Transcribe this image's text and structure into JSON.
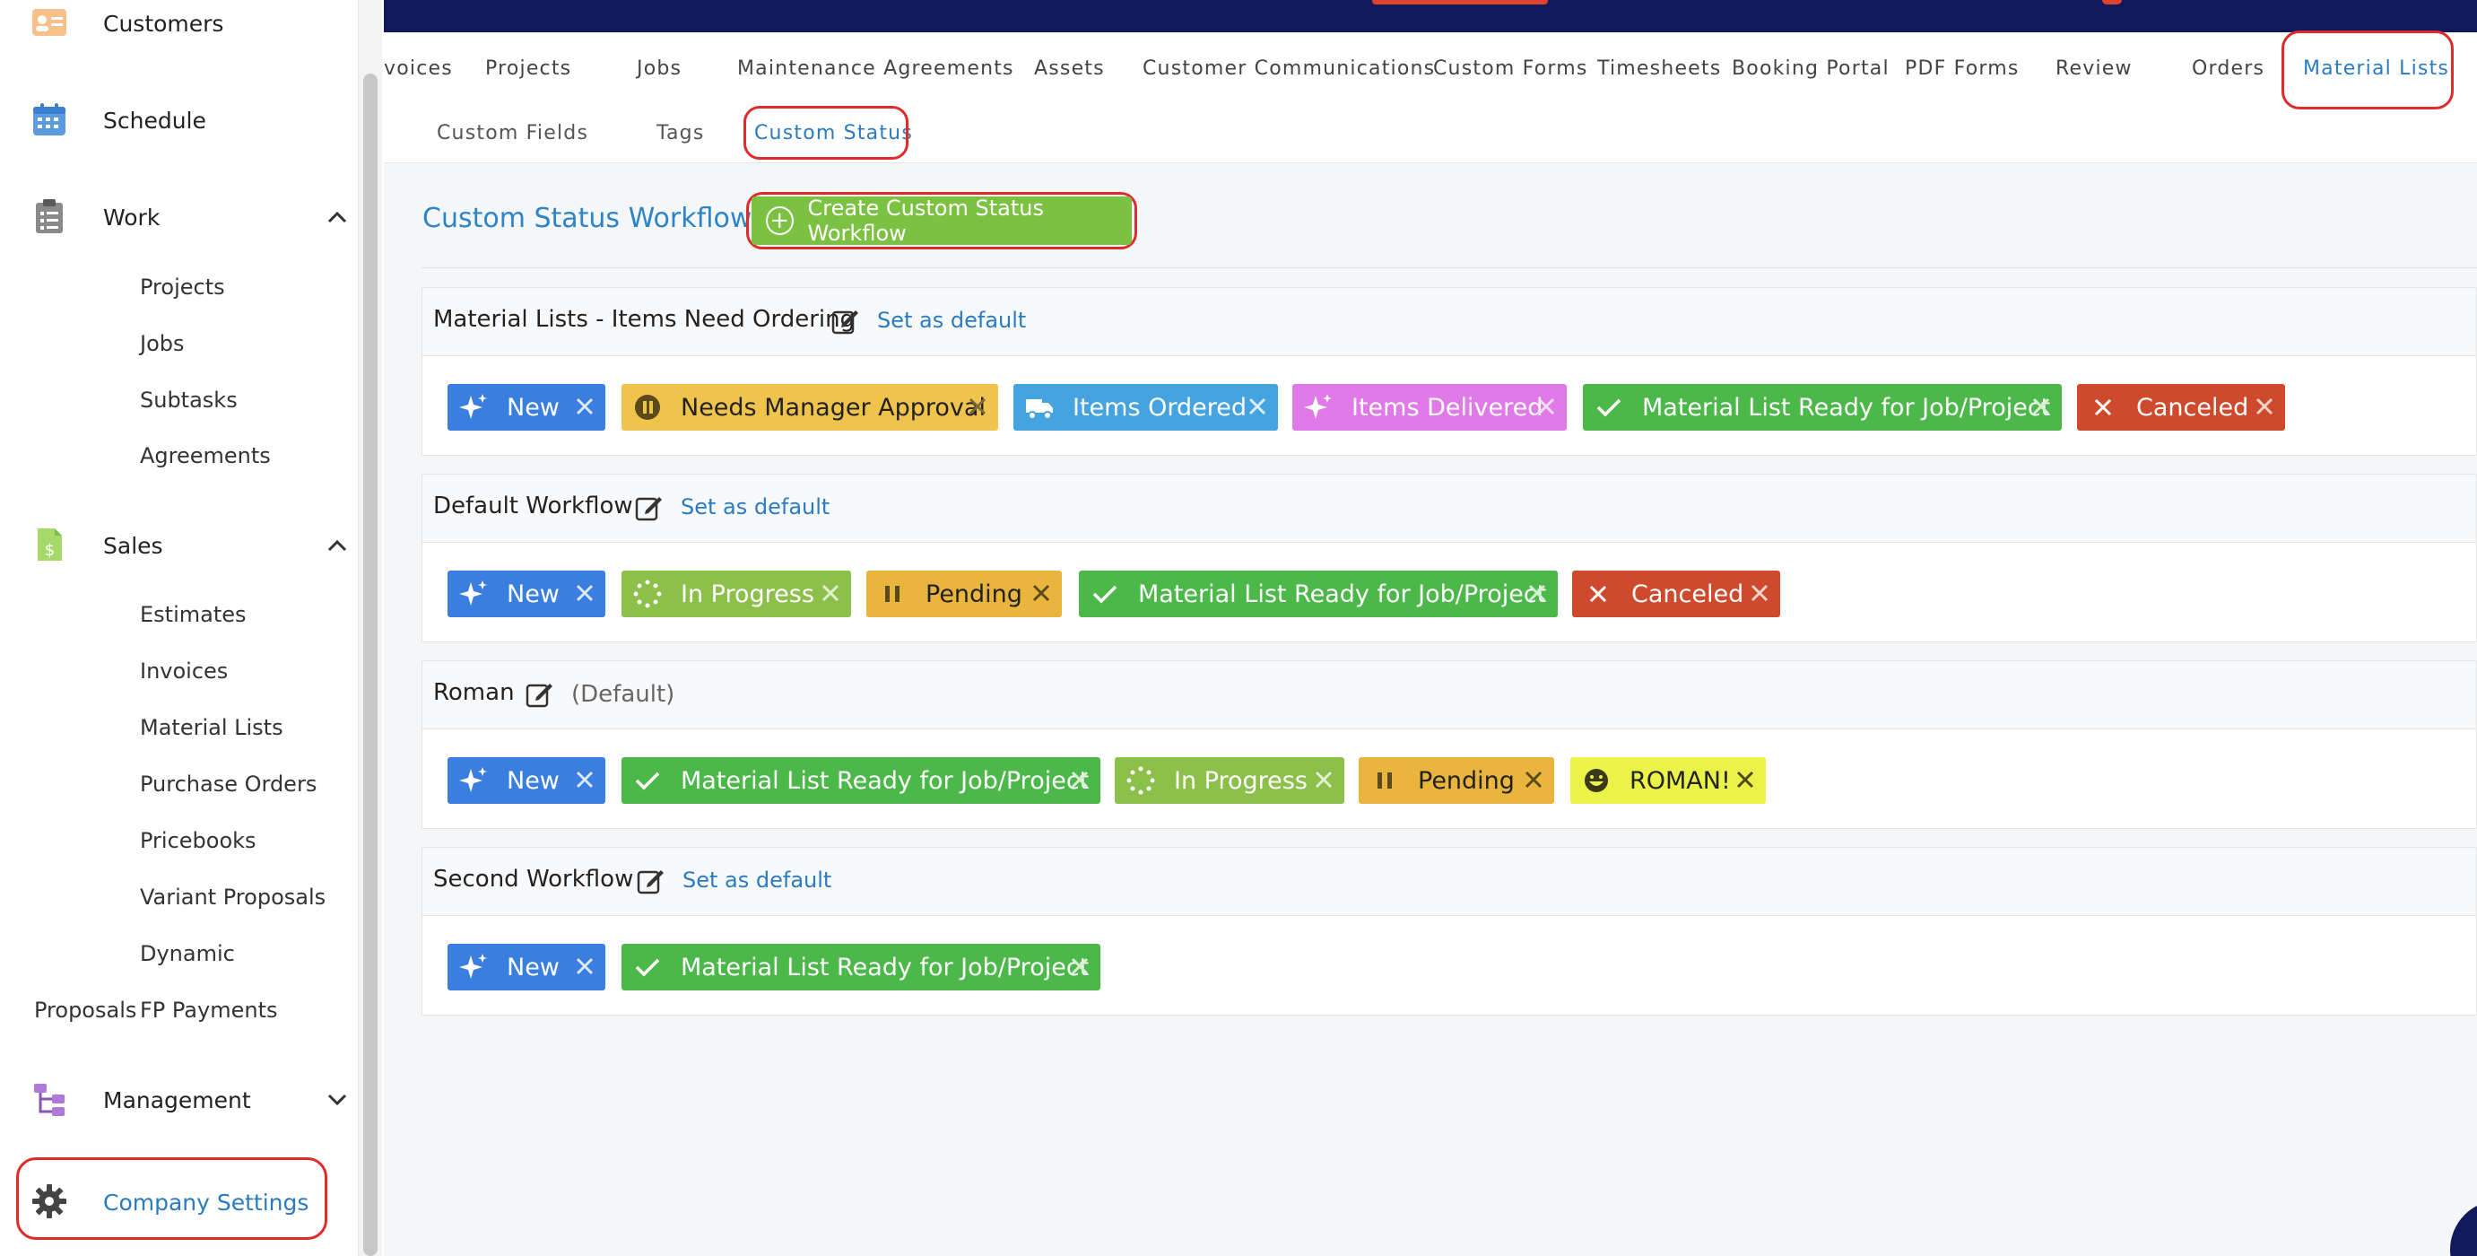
{
  "sidebar": {
    "customers": "Customers",
    "schedule": "Schedule",
    "work": "Work",
    "work_items": [
      "Projects",
      "Jobs",
      "Subtasks",
      "Agreements"
    ],
    "sales": "Sales",
    "sales_items": [
      "Estimates",
      "Invoices",
      "Material Lists",
      "Purchase Orders",
      "Pricebooks",
      "Variant Proposals",
      "Dynamic"
    ],
    "proposals_label": "Proposals",
    "fp_payments": "FP Payments",
    "management": "Management",
    "company_settings": "Company Settings"
  },
  "tabs": [
    "voices",
    "Projects",
    "Jobs",
    "Maintenance Agreements",
    "Assets",
    "Customer Communications",
    "Custom Forms",
    "Timesheets",
    "Booking Portal",
    "PDF Forms",
    "Review",
    "Orders",
    "Material Lists"
  ],
  "active_tab": "Material Lists",
  "subtabs": [
    "Custom Fields",
    "Tags",
    "Custom Status"
  ],
  "active_subtab": "Custom Status",
  "page": {
    "title": "Custom Status Workflows",
    "create_button": "Create Custom Status Workflow"
  },
  "workflows": [
    {
      "name": "Material Lists - Items Need Ordering",
      "link": "Set as default",
      "statuses": [
        "New",
        "Needs Manager Approval",
        "Items Ordered",
        "Items Delivered",
        "Material List Ready for Job/Project",
        "Canceled"
      ]
    },
    {
      "name": "Default Workflow",
      "link": "Set as default",
      "statuses": [
        "New",
        "In Progress",
        "Pending",
        "Material List Ready for Job/Project",
        "Canceled"
      ]
    },
    {
      "name": "Roman",
      "default_label": "(Default)",
      "statuses": [
        "New",
        "Material List Ready for Job/Project",
        "In Progress",
        "Pending",
        "ROMAN!"
      ]
    },
    {
      "name": "Second Workflow",
      "link": "Set as default",
      "statuses": [
        "New",
        "Material List Ready for Job/Project"
      ]
    }
  ],
  "icons": {
    "new": "sparkle-icon",
    "needs_manager_approval": "pause-circle-icon",
    "items_ordered": "truck-icon",
    "items_delivered": "sparkle-icon",
    "ready": "check-icon",
    "canceled": "x-icon",
    "in_progress": "spinner-icon",
    "pending": "pause-icon",
    "roman": "grin-face-icon"
  },
  "colors": {
    "accent": "#2b7bc2",
    "banner": "#10195c",
    "create_button": "#7cc242",
    "new": "#3a7ee0",
    "needs_manager_approval": "#f0c44c",
    "items_ordered": "#45a3e0",
    "items_delivered": "#e07ae8",
    "ready": "#4cb84a",
    "canceled": "#cf4a2c",
    "in_progress": "#8cc04a",
    "pending": "#e9b53c",
    "roman": "#ecf348",
    "highlight": "#e02b2b"
  }
}
